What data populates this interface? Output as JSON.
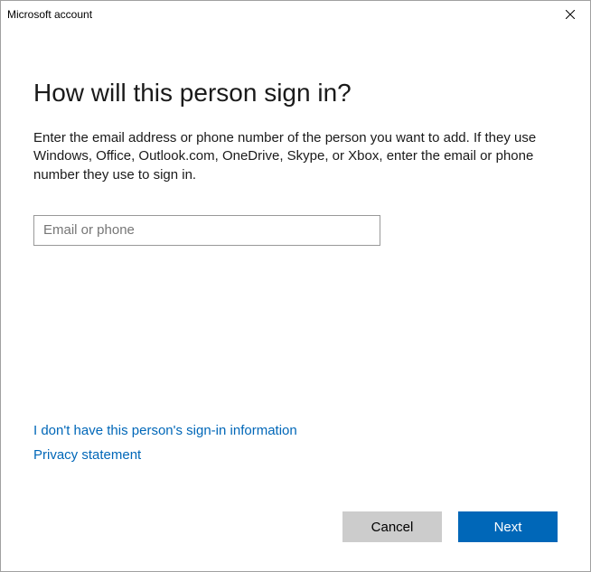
{
  "titlebar": {
    "title": "Microsoft account"
  },
  "heading": "How will this person sign in?",
  "instruction": "Enter the email address or phone number of the person you want to add. If they use Windows, Office, Outlook.com, OneDrive, Skype, or Xbox, enter the email or phone number they use to sign in.",
  "input": {
    "placeholder": "Email or phone",
    "value": ""
  },
  "links": {
    "no_info": "I don't have this person's sign-in information",
    "privacy": "Privacy statement"
  },
  "buttons": {
    "cancel": "Cancel",
    "next": "Next"
  }
}
